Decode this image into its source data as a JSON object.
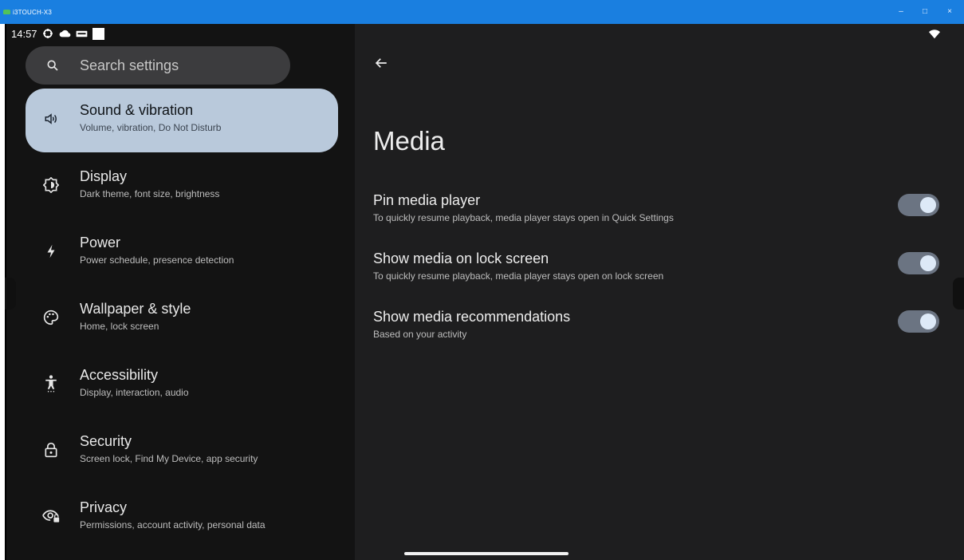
{
  "window": {
    "title": "i3TOUCH-X3",
    "controls": {
      "minimize": "–",
      "maximize": "□",
      "close": "×"
    }
  },
  "status_bar": {
    "time": "14:57",
    "icons": [
      "settings-gear-icon",
      "cloud-icon",
      "keyboard-icon",
      "blank-square-icon"
    ],
    "wifi": "wifi-icon"
  },
  "search": {
    "placeholder": "Search settings",
    "icon": "search-icon"
  },
  "settings_list": [
    {
      "label": "Sound & vibration",
      "summary": "Volume, vibration, Do Not Disturb",
      "icon": "volume-icon",
      "selected": true
    },
    {
      "label": "Display",
      "summary": "Dark theme, font size, brightness",
      "icon": "brightness-icon",
      "selected": false
    },
    {
      "label": "Power",
      "summary": "Power schedule, presence detection",
      "icon": "bolt-icon",
      "selected": false
    },
    {
      "label": "Wallpaper & style",
      "summary": "Home, lock screen",
      "icon": "palette-icon",
      "selected": false
    },
    {
      "label": "Accessibility",
      "summary": "Display, interaction, audio",
      "icon": "accessibility-icon",
      "selected": false
    },
    {
      "label": "Security",
      "summary": "Screen lock, Find My Device, app security",
      "icon": "lock-icon",
      "selected": false
    },
    {
      "label": "Privacy",
      "summary": "Permissions, account activity, personal data",
      "icon": "privacy-eye-icon",
      "selected": false
    }
  ],
  "detail": {
    "back_icon": "back-arrow-icon",
    "title": "Media",
    "preferences": [
      {
        "title": "Pin media player",
        "summary": "To quickly resume playback, media player stays open in Quick Settings",
        "enabled": true
      },
      {
        "title": "Show media on lock screen",
        "summary": "To quickly resume playback, media player stays open on lock screen",
        "enabled": true
      },
      {
        "title": "Show media recommendations",
        "summary": "Based on your activity",
        "enabled": true
      }
    ]
  },
  "colors": {
    "titlebar": "#1a7fe0",
    "left_pane": "#131313",
    "right_pane": "#1e1e1f",
    "selected_item": "#b9c9db",
    "toggle_track": "#6b7482",
    "toggle_knob": "#dde9f7"
  }
}
